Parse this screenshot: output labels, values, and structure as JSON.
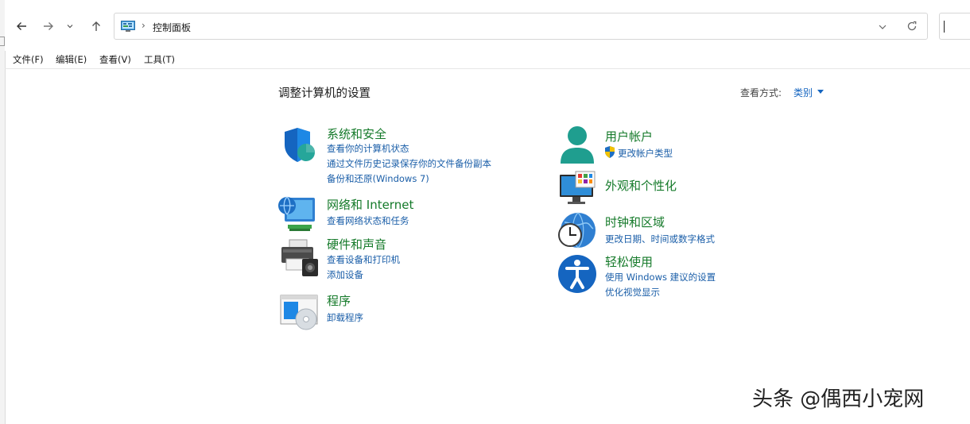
{
  "address_bar": {
    "path": "控制面板"
  },
  "menu": {
    "items": [
      "文件(F)",
      "编辑(E)",
      "查看(V)",
      "工具(T)"
    ]
  },
  "main": {
    "title": "调整计算机的设置",
    "view_by_label": "查看方式:",
    "view_by_value": "类别"
  },
  "categories": {
    "system_security": {
      "title": "系统和安全",
      "links": [
        "查看你的计算机状态",
        "通过文件历史记录保存你的文件备份副本",
        "备份和还原(Windows 7)"
      ]
    },
    "network": {
      "title": "网络和 Internet",
      "links": [
        "查看网络状态和任务"
      ]
    },
    "hardware": {
      "title": "硬件和声音",
      "links": [
        "查看设备和打印机",
        "添加设备"
      ]
    },
    "programs": {
      "title": "程序",
      "links": [
        "卸载程序"
      ]
    },
    "user_accounts": {
      "title": "用户帐户",
      "links": [
        "更改帐户类型"
      ]
    },
    "appearance": {
      "title": "外观和个性化",
      "links": []
    },
    "clock_region": {
      "title": "时钟和区域",
      "links": [
        "更改日期、时间或数字格式"
      ]
    },
    "ease_of_access": {
      "title": "轻松使用",
      "links": [
        "使用 Windows 建议的设置",
        "优化视觉显示"
      ]
    }
  },
  "watermark": {
    "text": "头条 @偶西小宠网"
  },
  "colors": {
    "category_title": "#157a2a",
    "link": "#1a5ea8",
    "accent_blue": "#1565c0"
  }
}
